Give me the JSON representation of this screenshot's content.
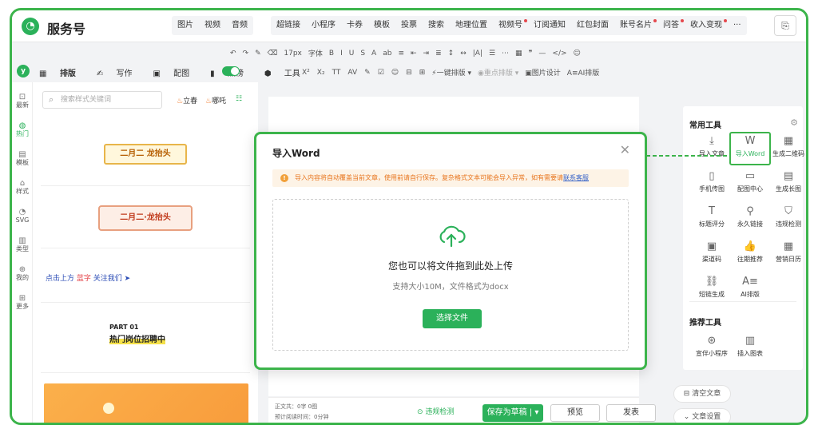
{
  "header": {
    "brand": "服务号",
    "nav_left": [
      {
        "label": "图片",
        "dot": false
      },
      {
        "label": "视频",
        "dot": false
      },
      {
        "label": "音频",
        "dot": false
      }
    ],
    "nav_main": [
      {
        "label": "超链接",
        "dot": false
      },
      {
        "label": "小程序",
        "dot": false
      },
      {
        "label": "卡券",
        "dot": false
      },
      {
        "label": "模板",
        "dot": false
      },
      {
        "label": "投票",
        "dot": false
      },
      {
        "label": "搜索",
        "dot": false
      },
      {
        "label": "地理位置",
        "dot": false
      },
      {
        "label": "视频号",
        "dot": true
      },
      {
        "label": "订阅通知",
        "dot": false
      },
      {
        "label": "红包封面",
        "dot": false
      },
      {
        "label": "账号名片",
        "dot": true
      },
      {
        "label": "问答",
        "dot": true
      },
      {
        "label": "收入变现",
        "dot": true
      },
      {
        "label": "···",
        "dot": false
      }
    ]
  },
  "toolbar": {
    "row1": [
      "↶",
      "↷",
      "✎",
      "⌫",
      "17px",
      "字体",
      "B",
      "I",
      "U",
      "S",
      "A",
      "ab",
      "≡",
      "⇤",
      "⇥",
      "≣",
      "↕",
      "↔",
      "|A|",
      "☰",
      "⋯",
      "▦",
      "❞",
      "—",
      "</>",
      "☺"
    ],
    "row2": [
      "X²",
      "X₂",
      "TT",
      "AV",
      "✎",
      "☑",
      "☺",
      "⊟",
      "⊞"
    ],
    "one_click_layout": "一键排版",
    "style_layout": "重点排版",
    "image_design": "图片设计",
    "ai_layout": "AI排版"
  },
  "left_tabs": [
    {
      "label": "排版",
      "icon": "layout-icon",
      "active": true
    },
    {
      "label": "写作",
      "icon": "pen-icon",
      "active": false
    },
    {
      "label": "配图",
      "icon": "image-icon",
      "active": false
    },
    {
      "label": "热榜",
      "icon": "hot-icon",
      "active": false
    },
    {
      "label": "工具",
      "icon": "tool-icon",
      "active": false
    }
  ],
  "left_rail": [
    {
      "label": "最新",
      "active": false
    },
    {
      "label": "热门",
      "active": true
    },
    {
      "label": "模板",
      "active": false
    },
    {
      "label": "样式",
      "active": false
    },
    {
      "label": "SVG",
      "active": false
    },
    {
      "label": "类型",
      "active": false
    },
    {
      "label": "我的",
      "active": false
    },
    {
      "label": "更多",
      "active": false
    }
  ],
  "template_panel": {
    "search_placeholder": "搜索样式关键词",
    "tag1": "立春",
    "tag2": "哪吒",
    "card1_text": "二月二 龙抬头",
    "card2_text": "二月二·龙抬头",
    "card3_prefix": "点击上方",
    "card3_blue": "蓝字",
    "card3_suffix": "关注我们",
    "card4_part": "PART 01",
    "card4_title": "热门岗位招聘中"
  },
  "modal": {
    "title": "导入Word",
    "warning_text": "导入内容将自动覆盖当前文章，使用前请自行保存。复杂格式文本可能会导入异常，如有需要请",
    "warning_link": "联系客服",
    "drop_main": "您也可以将文件拖到此处上传",
    "drop_sub": "支持大小10M，文件格式为docx",
    "choose_button": "选择文件"
  },
  "bottom_bar": {
    "word_count": "正文共：0字 0图",
    "reading_time": "预计阅读时间：0分钟",
    "violation_check": "违规检测",
    "save_draft": "保存为草稿",
    "preview": "预览",
    "publish": "发表"
  },
  "right_panel": {
    "common_title": "常用工具",
    "common_tools": [
      {
        "label": "导入文章",
        "icon": "download-icon",
        "glyph": "⤓"
      },
      {
        "label": "导入Word",
        "icon": "word-icon",
        "glyph": "W"
      },
      {
        "label": "生成二维码",
        "icon": "qrcode-icon",
        "glyph": "▦"
      },
      {
        "label": "手机传图",
        "icon": "phone-icon",
        "glyph": "▯"
      },
      {
        "label": "配图中心",
        "icon": "picture-icon",
        "glyph": "▭"
      },
      {
        "label": "生成长图",
        "icon": "long-image-icon",
        "glyph": "▤"
      },
      {
        "label": "标题评分",
        "icon": "title-icon",
        "glyph": "T"
      },
      {
        "label": "永久链接",
        "icon": "link-icon",
        "glyph": "⚲"
      },
      {
        "label": "违规检测",
        "icon": "shield-icon",
        "glyph": "⛉"
      },
      {
        "label": "渠道码",
        "icon": "channel-code-icon",
        "glyph": "▣"
      },
      {
        "label": "往期推荐",
        "icon": "thumbs-up-icon",
        "glyph": "👍"
      },
      {
        "label": "营销日历",
        "icon": "calendar-icon",
        "glyph": "▦"
      },
      {
        "label": "短链生成",
        "icon": "short-link-icon",
        "glyph": "⛓"
      },
      {
        "label": "AI排版",
        "icon": "ai-layout-icon",
        "glyph": "A≡"
      }
    ],
    "recommend_title": "推荐工具",
    "recommend_tools": [
      {
        "label": "宣伴小程序",
        "icon": "mini-program-icon",
        "glyph": "⊛"
      },
      {
        "label": "插入图表",
        "icon": "chart-icon",
        "glyph": "▥"
      }
    ],
    "clear_article": "清空文章",
    "article_settings": "文章设置"
  },
  "colors": {
    "accent": "#2bb15a",
    "warning": "#e8761f",
    "dot": "#e5484d"
  }
}
